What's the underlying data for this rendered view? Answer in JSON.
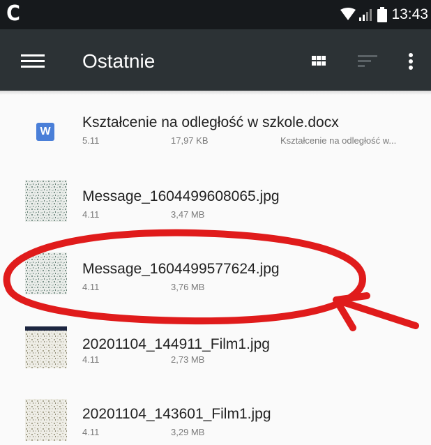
{
  "status_bar": {
    "app_icon_glyph": "C",
    "time": "13:43",
    "icons": [
      "wifi-icon",
      "signal-icon",
      "battery-icon"
    ]
  },
  "app_bar": {
    "title": "Ostatnie",
    "icons": [
      "menu-icon",
      "grid-view-icon",
      "sort-icon",
      "more-vert-icon"
    ]
  },
  "files": [
    {
      "name": "Kształcenie na odległość w szkole.docx",
      "date": "5.11",
      "size": "17,97 KB",
      "location": "Kształcenie na odległość w...",
      "type": "docx",
      "icon_letter": "W"
    },
    {
      "name": "Message_1604499608065.jpg",
      "date": "4.11",
      "size": "3,47 MB",
      "type": "jpg"
    },
    {
      "name": "Message_1604499577624.jpg",
      "date": "4.11",
      "size": "3,76 MB",
      "type": "jpg"
    },
    {
      "name": "20201104_144911_Film1.jpg",
      "date": "4.11",
      "size": "2,73 MB",
      "type": "jpg"
    },
    {
      "name": "20201104_143601_Film1.jpg",
      "date": "4.11",
      "size": "3,29 MB",
      "type": "jpg"
    }
  ],
  "colors": {
    "status_bar": "#16191c",
    "app_bar": "#2c3235",
    "background": "#fafafa",
    "doc_icon": "#4a7fd8",
    "annotation": "#e01b1b"
  }
}
